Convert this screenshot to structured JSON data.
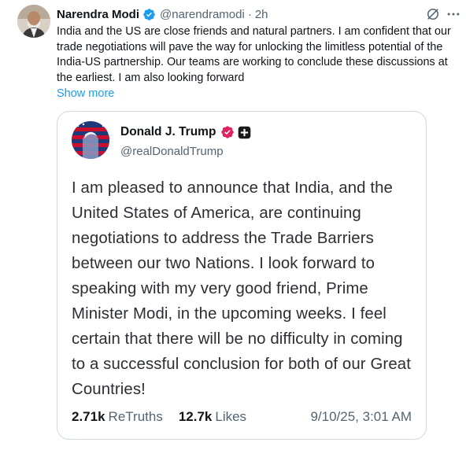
{
  "post": {
    "author_name": "Narendra Modi",
    "author_handle": "@narendramodi",
    "separator": "·",
    "time": "2h",
    "text": "India and the US are close friends and natural partners. I am confident that our trade negotiations will pave the way for unlocking the limitless potential of the India-US partnership. Our teams are working to conclude these discussions at the earliest. I am also looking forward",
    "show_more": "Show more",
    "icons": [
      "verified-badge-icon",
      "grok-icon",
      "more-options-icon"
    ]
  },
  "quoted": {
    "author_name": "Donald J. Trump",
    "author_handle": "@realDonaldTrump",
    "text": "I am pleased to announce that India, and the United States of America, are continuing negotiations to address the Trade Barriers between our two Nations. I look forward to speaking with my very good friend, Prime Minister Modi, in the upcoming weeks. I feel certain that there will be no difficulty in coming to a successful conclusion for both of our Great Countries!",
    "retruths_count": "2.71k",
    "retruths_label": "ReTruths",
    "likes_count": "12.7k",
    "likes_label": "Likes",
    "timestamp": "9/10/25, 3:01 AM",
    "icons": [
      "verified-badge-icon",
      "plus-icon"
    ]
  },
  "colors": {
    "link_blue": "#1d9bf0",
    "verified_blue": "#1d9bf0",
    "truth_badge_red": "#e0245e",
    "muted_text": "#536471",
    "border": "#cfd9de"
  }
}
